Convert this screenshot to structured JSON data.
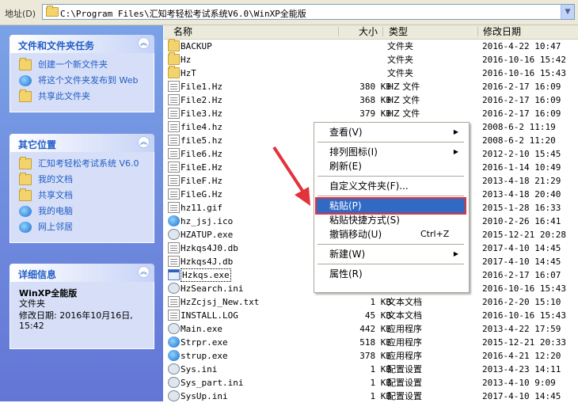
{
  "address": {
    "label": "地址(D)",
    "path": "C:\\Program Files\\汇知考轻松考试系统V6.0\\WinXP全能版"
  },
  "tasks_panel": {
    "title": "文件和文件夹任务",
    "items": [
      {
        "label": "创建一个新文件夹",
        "icon": "new-folder-icon"
      },
      {
        "label": "将这个文件夹发布到 Web",
        "icon": "publish-web-icon"
      },
      {
        "label": "共享此文件夹",
        "icon": "share-folder-icon"
      }
    ]
  },
  "places_panel": {
    "title": "其它位置",
    "items": [
      {
        "label": "汇知考轻松考试系统 V6.0",
        "icon": "folder-icon"
      },
      {
        "label": "我的文档",
        "icon": "my-documents-icon"
      },
      {
        "label": "共享文档",
        "icon": "shared-documents-icon"
      },
      {
        "label": "我的电脑",
        "icon": "my-computer-icon"
      },
      {
        "label": "网上邻居",
        "icon": "network-icon"
      }
    ]
  },
  "details_panel": {
    "title": "详细信息",
    "name": "WinXP全能版",
    "type": "文件夹",
    "modified_label": "修改日期: 2016年10月16日, 15:42"
  },
  "columns": {
    "name": "名称",
    "size": "大小",
    "type": "类型",
    "date": "修改日期"
  },
  "files": [
    {
      "name": "BACKUP",
      "size": "",
      "type": "文件夹",
      "date": "2016-4-22 10:47",
      "icon": "folder"
    },
    {
      "name": "Hz",
      "size": "",
      "type": "文件夹",
      "date": "2016-10-16 15:42",
      "icon": "folder"
    },
    {
      "name": "HzT",
      "size": "",
      "type": "文件夹",
      "date": "2016-10-16 15:43",
      "icon": "folder"
    },
    {
      "name": "File1.Hz",
      "size": "380 KB",
      "type": "HZ 文件",
      "date": "2016-2-17 16:09",
      "icon": "doc"
    },
    {
      "name": "File2.Hz",
      "size": "368 KB",
      "type": "HZ 文件",
      "date": "2016-2-17 16:09",
      "icon": "doc"
    },
    {
      "name": "File3.Hz",
      "size": "379 KB",
      "type": "HZ 文件",
      "date": "2016-2-17 16:09",
      "icon": "doc"
    },
    {
      "name": "file4.hz",
      "size": "",
      "type": "",
      "date": "2008-6-2 11:19",
      "icon": "doc"
    },
    {
      "name": "file5.hz",
      "size": "",
      "type": "",
      "date": "2008-6-2 11:20",
      "icon": "doc"
    },
    {
      "name": "File6.Hz",
      "size": "",
      "type": "",
      "date": "2012-2-10 15:45",
      "icon": "doc"
    },
    {
      "name": "FileE.Hz",
      "size": "",
      "type": "",
      "date": "2016-1-14 10:49",
      "icon": "doc"
    },
    {
      "name": "FileF.Hz",
      "size": "",
      "type": "",
      "date": "2013-4-18 21:29",
      "icon": "doc"
    },
    {
      "name": "FileG.Hz",
      "size": "",
      "type": "",
      "date": "2013-4-18 20:40",
      "icon": "doc"
    },
    {
      "name": "hz11.gif",
      "size": "",
      "type": "",
      "date": "2015-1-28 16:33",
      "icon": "doc"
    },
    {
      "name": "hz_jsj.ico",
      "size": "",
      "type": "",
      "date": "2010-2-26 16:41",
      "icon": "globe"
    },
    {
      "name": "HZATUP.exe",
      "size": "",
      "type": "",
      "date": "2015-12-21 20:28",
      "icon": "gear"
    },
    {
      "name": "Hzkqs4J0.db",
      "size": "",
      "type": "",
      "date": "2017-4-10 14:45",
      "icon": "doc"
    },
    {
      "name": "Hzkqs4J.db",
      "size": "",
      "type": "",
      "date": "2017-4-10 14:45",
      "icon": "doc"
    },
    {
      "name": "Hzkqs.exe",
      "size": "",
      "type": "",
      "date": "2016-2-17 16:07",
      "icon": "exe"
    },
    {
      "name": "HzSearch.ini",
      "size": "",
      "type": "",
      "date": "2016-10-16 15:43",
      "icon": "gear"
    },
    {
      "name": "HzZcjsj_New.txt",
      "size": "1 KB",
      "type": "文本文档",
      "date": "2016-2-20 15:10",
      "icon": "doc"
    },
    {
      "name": "INSTALL.LOG",
      "size": "45 KB",
      "type": "文本文档",
      "date": "2016-10-16 15:43",
      "icon": "doc"
    },
    {
      "name": "Main.exe",
      "size": "442 KB",
      "type": "应用程序",
      "date": "2013-4-22 17:59",
      "icon": "gear"
    },
    {
      "name": "Strpr.exe",
      "size": "518 KB",
      "type": "应用程序",
      "date": "2015-12-21 20:33",
      "icon": "globe"
    },
    {
      "name": "strup.exe",
      "size": "378 KB",
      "type": "应用程序",
      "date": "2016-4-21 12:20",
      "icon": "globe"
    },
    {
      "name": "Sys.ini",
      "size": "1 KB",
      "type": "配置设置",
      "date": "2013-4-23 14:11",
      "icon": "gear"
    },
    {
      "name": "Sys_part.ini",
      "size": "1 KB",
      "type": "配置设置",
      "date": "2013-4-10 9:09",
      "icon": "gear"
    },
    {
      "name": "SysUp.ini",
      "size": "1 KB",
      "type": "配置设置",
      "date": "2017-4-10 14:45",
      "icon": "gear"
    }
  ],
  "context_menu": {
    "items": [
      {
        "label": "查看(V)",
        "shortcut": "",
        "submenu": true
      },
      {
        "sep": true
      },
      {
        "label": "排列图标(I)",
        "shortcut": "",
        "submenu": true
      },
      {
        "label": "刷新(E)",
        "shortcut": "",
        "submenu": false
      },
      {
        "sep": true
      },
      {
        "label": "自定义文件夹(F)...",
        "shortcut": "",
        "submenu": false
      },
      {
        "sep": true
      },
      {
        "label": "粘贴(P)",
        "shortcut": "",
        "submenu": false,
        "highlight": true
      },
      {
        "label": "粘贴快捷方式(S)",
        "shortcut": "",
        "submenu": false
      },
      {
        "label": "撤销移动(U)",
        "shortcut": "Ctrl+Z",
        "submenu": false
      },
      {
        "sep": true
      },
      {
        "label": "新建(W)",
        "shortcut": "",
        "submenu": true
      },
      {
        "sep": true
      },
      {
        "label": "属性(R)",
        "shortcut": "",
        "submenu": false
      }
    ]
  },
  "colors": {
    "highlight": "#316ac5",
    "annotation": "#e2333c",
    "link": "#215dc6"
  }
}
